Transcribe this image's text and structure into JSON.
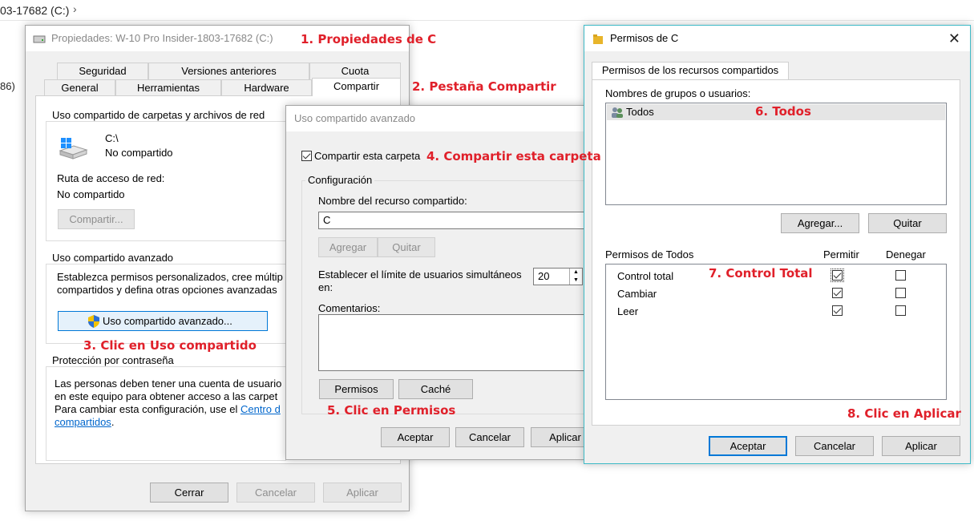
{
  "explorer": {
    "breadcrumb": "03-17682 (C:)",
    "side_text": "86)"
  },
  "props": {
    "title": "Propiedades: W-10 Pro Insider-1803-17682 (C:)",
    "tabs_row1": [
      "Seguridad",
      "Versiones anteriores",
      "Cuota"
    ],
    "tabs_row2": [
      "General",
      "Herramientas",
      "Hardware",
      "Compartir"
    ],
    "net_group": "Uso compartido de carpetas y archivos de red",
    "drive_name": "C:\\",
    "drive_status": "No compartido",
    "path_label": "Ruta de acceso de red:",
    "path_value": "No compartido",
    "share_btn": "Compartir...",
    "adv_group": "Uso compartido avanzado",
    "adv_desc1": "Establezca permisos personalizados, cree múltip",
    "adv_desc2": "compartidos y defina otras opciones avanzadas",
    "adv_btn": "Uso compartido avanzado...",
    "pwd_group": "Protección por contraseña",
    "pwd_desc1": "Las personas deben tener una cuenta de usuario",
    "pwd_desc2": "en este equipo para obtener acceso a las carpet",
    "pwd_desc3_pre": "Para cambiar esta configuración, use el ",
    "pwd_link1": "Centro d",
    "pwd_link2": "compartidos",
    "pwd_desc4_post": ".",
    "btn_close": "Cerrar",
    "btn_cancel": "Cancelar",
    "btn_apply": "Aplicar"
  },
  "adv": {
    "title": "Uso compartido avanzado",
    "share_check": "Compartir esta carpeta",
    "config_group": "Configuración",
    "name_label": "Nombre del recurso compartido:",
    "name_value": "C",
    "btn_add": "Agregar",
    "btn_remove": "Quitar",
    "limit_label1": "Establecer el límite de usuarios simultáneos",
    "limit_label2": "en:",
    "limit_value": "20",
    "comments_label": "Comentarios:",
    "btn_permissions": "Permisos",
    "btn_cache": "Caché",
    "btn_ok": "Aceptar",
    "btn_cancel": "Cancelar",
    "btn_apply": "Aplicar"
  },
  "perm": {
    "title": "Permisos de C",
    "tab": "Permisos de los recursos compartidos",
    "users_label": "Nombres de grupos o usuarios:",
    "user": "Todos",
    "btn_add": "Agregar...",
    "btn_remove": "Quitar",
    "perm_label": "Permisos de Todos",
    "col_allow": "Permitir",
    "col_deny": "Denegar",
    "rows": [
      {
        "name": "Control total",
        "allow": true,
        "deny": false
      },
      {
        "name": "Cambiar",
        "allow": true,
        "deny": false
      },
      {
        "name": "Leer",
        "allow": true,
        "deny": false
      }
    ],
    "btn_ok": "Aceptar",
    "btn_cancel": "Cancelar",
    "btn_apply": "Aplicar"
  },
  "annotations": {
    "a1": "1. Propiedades de C",
    "a2": "2. Pestaña Compartir",
    "a3": "3. Clic en Uso compartido",
    "a4": "4. Compartir esta carpeta",
    "a5": "5. Clic en Permisos",
    "a6": "6. Todos",
    "a7": "7. Control Total",
    "a8": "8. Clic en Aplicar"
  },
  "colors": {
    "accent": "#0078d7",
    "annotation": "#e0202a",
    "title_bar_active": "#3ebac7"
  }
}
